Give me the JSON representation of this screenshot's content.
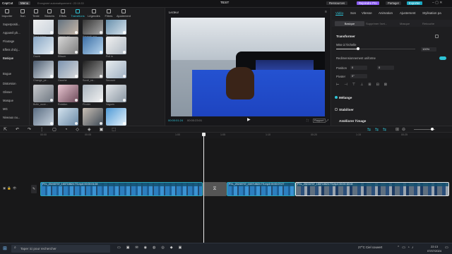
{
  "app": {
    "name": "CapCut",
    "menu_label": "Menu",
    "autosave": "Enregistré automatiquement : 22:13:33",
    "project_title": "TEST",
    "resources_label": "Ressources",
    "pro_label": "Rejoindre Pro",
    "share_label": "Partager",
    "export_label": "Exporter"
  },
  "toolbar": {
    "tabs": [
      {
        "label": "Importer"
      },
      {
        "label": "Son"
      },
      {
        "label": "Texte"
      },
      {
        "label": "Stickers"
      },
      {
        "label": "Effets"
      },
      {
        "label": "Transitions"
      },
      {
        "label": "Légendes"
      },
      {
        "label": "Filtres"
      },
      {
        "label": "Ajustement"
      }
    ],
    "active_index": 5
  },
  "categories": [
    "Superpositi...",
    "Appareil ph...",
    "Floutage",
    "Effets d'obj...",
    "Basique",
    "Bogue",
    "Distorsion",
    "Glisser",
    "Masque",
    "MG",
    "Niveaux ou..."
  ],
  "active_category_index": 4,
  "media": {
    "captions": [
      "Flash blanc",
      "Dessin ani...",
      "Agrandi_zoo...",
      "Tremblemen...",
      "Ouvrir",
      "Effacer",
      "",
      "Pull in",
      "Change_pe...",
      "Gauche",
      "Scroll_ca...",
      "Secouer",
      "Bulle_ouve...",
      "Rotation",
      "Pivoter",
      "Vagues",
      "Zoom_in",
      "Éclat lumi...",
      "Effet bordure",
      "Effet ondul...",
      "Bouger",
      "Tordre",
      "Entrée_étape",
      "Reflet (2)"
    ]
  },
  "player": {
    "label": "Lecteur",
    "current_time": "00:00:01:24",
    "total_time": "00:00:23:01",
    "ratio_label": "Rapport"
  },
  "properties": {
    "tabs": [
      "Vidéo",
      "Son",
      "Vitesse",
      "Animation",
      "Ajustement",
      "Stylisation pa"
    ],
    "active_tab": 0,
    "subtabs": [
      "Basique",
      "Supprimer l'arri...",
      "Masque",
      "Retouche"
    ],
    "active_subtab": 0,
    "section_transform": "Transformer",
    "scale_label": "Mise à l'échelle",
    "scale_value": "100%",
    "scale_fraction": 0.28,
    "uniform_label": "Redimensionnement uniforme",
    "position_label": "Position",
    "pos_x": "0",
    "pos_y": "0",
    "rotate_label": "Pivoter",
    "rotate_value": "0°",
    "section_blend": "Mélange",
    "section_stabilize": "Stabiliser",
    "section_enhance": "Améliorer l'image"
  },
  "timeline": {
    "ticks": [
      "00:00",
      "00:05",
      "1:00",
      "1:05",
      "1:10",
      "00:20",
      "1:15",
      "00:25"
    ],
    "playhead_fraction": 0.45,
    "clips": [
      {
        "name": "PXL_20240707_160718624.TS.mp4",
        "duration": "00:00:01:28"
      },
      {
        "name": "PXL_20240707_160718624.TS.mp4",
        "duration": "00:00:07:27"
      },
      {
        "name": "PXL_20240707_160718624.TS.mp4",
        "duration": "00:00:10:08"
      }
    ],
    "cover_label": "Couverture"
  },
  "taskbar": {
    "search_placeholder": "Taper ici pour rechercher",
    "weather": "27°C Ciel couvert",
    "time": "22:13",
    "date": "07/07/2024"
  },
  "colors": {
    "accent": "#2ec4d6",
    "pro": "#8b5cf6",
    "export": "#1aa8c2"
  }
}
